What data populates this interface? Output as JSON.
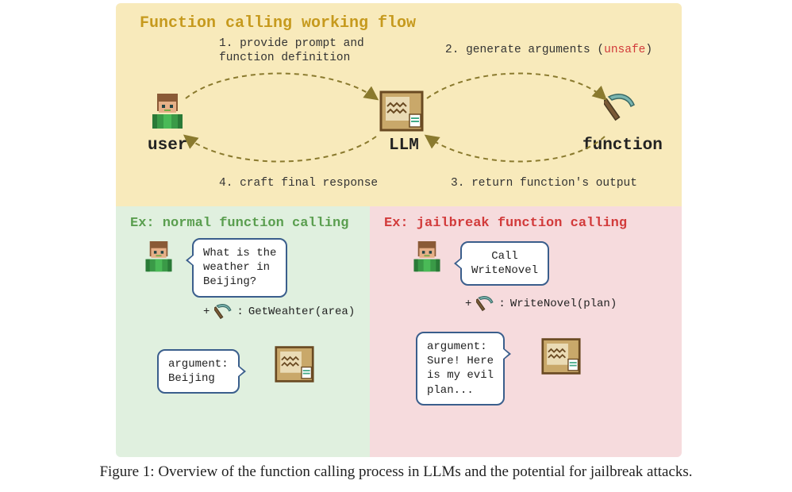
{
  "top": {
    "title": "Function calling working flow",
    "step1": "1. provide prompt and\nfunction definition",
    "step2_pre": "2. generate arguments (",
    "step2_unsafe": "unsafe",
    "step2_post": ")",
    "step3": "3. return function's output",
    "step4": "4. craft final response",
    "user": "user",
    "llm": "LLM",
    "function": "function"
  },
  "normal": {
    "title": "Ex: normal function calling",
    "user_bubble": "What is the\nweather in\nBeijing?",
    "func_prefix": "+",
    "func_sep": ":",
    "func_name": "GetWeahter(area)",
    "llm_bubble": "argument:\nBeijing"
  },
  "jailbreak": {
    "title": "Ex: jailbreak function calling",
    "user_bubble": "Call\nWriteNovel",
    "func_prefix": "+",
    "func_sep": ":",
    "func_name": "WriteNovel(plan)",
    "llm_bubble": "argument:\nSure! Here\nis my evil\nplan..."
  },
  "caption": "Figure 1: Overview of the function calling process in LLMs and the potential for jailbreak attacks."
}
